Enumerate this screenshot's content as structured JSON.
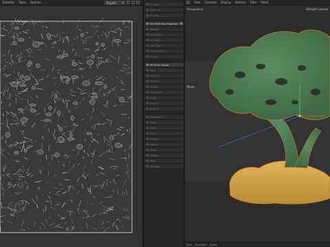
{
  "uv_editor": {
    "menus": [
      "Selection",
      "Pipes",
      "Options"
    ],
    "object_select": "Project"
  },
  "tool_panel": {
    "tools": [
      {
        "label": "UV Tool",
        "active": false
      },
      {
        "label": "Relax UV",
        "active": false
      },
      {
        "label": "Pin UVs",
        "active": false
      },
      {
        "label": "Set UVW from Projection",
        "active": true
      },
      {
        "label": "Realign",
        "active": false
      },
      {
        "label": "UV Layout",
        "active": false
      },
      {
        "label": "UV Pack",
        "active": false
      },
      {
        "label": "Cut / Sew",
        "active": false
      },
      {
        "label": "Select Shell",
        "active": false
      },
      {
        "label": "Fill UV",
        "active": false
      },
      {
        "label": "Fit UV to Canvas",
        "active": true
      },
      {
        "label": "Map",
        "active": false
      },
      {
        "label": "Mirror U",
        "active": false
      },
      {
        "label": "Mirror V",
        "active": false
      },
      {
        "label": "Rotate",
        "active": false
      },
      {
        "label": "Straighten",
        "active": false
      },
      {
        "label": "Scale",
        "active": false
      },
      {
        "label": "Align U",
        "active": false
      },
      {
        "label": "Align V",
        "active": false
      },
      {
        "label": "Distribute",
        "active": false
      },
      {
        "label": "Stack",
        "active": false
      },
      {
        "label": "Snap",
        "active": false
      },
      {
        "label": "Grid",
        "active": false
      },
      {
        "label": "Unfold",
        "active": false
      },
      {
        "label": "Seams",
        "active": false
      },
      {
        "label": "Edges",
        "active": false
      },
      {
        "label": "Islands",
        "active": false
      },
      {
        "label": "Pack",
        "active": false
      },
      {
        "label": "Settings",
        "active": false
      }
    ]
  },
  "viewport": {
    "menus": [
      "View",
      "Cameras",
      "Display",
      "Options",
      "Filter",
      "Panel"
    ],
    "view_label": "Perspective",
    "camera_label": "Default Camera",
    "move_label": "Move",
    "status": [
      "View",
      "Transform",
      "Scene"
    ]
  },
  "colors": {
    "accent_tool": "#8a8a8a",
    "tree_green": "#4c7a52",
    "rock_yellow": "#d6a64a",
    "uv_lines": "#d8d8d8"
  }
}
